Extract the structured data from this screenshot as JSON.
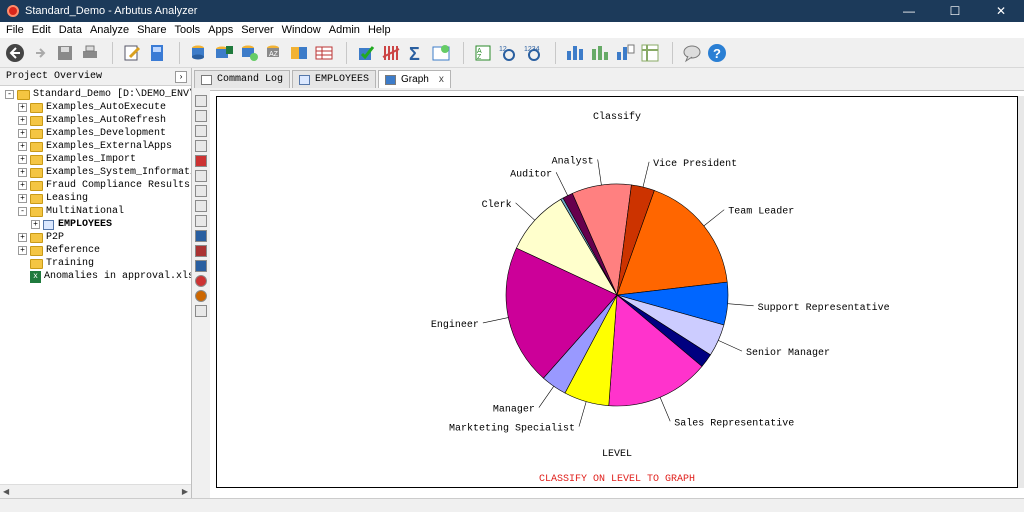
{
  "window": {
    "title": "Standard_Demo - Arbutus Analyzer",
    "minimize": "—",
    "maximize": "☐",
    "close": "✕"
  },
  "menu": [
    "File",
    "Edit",
    "Data",
    "Analyze",
    "Share",
    "Tools",
    "Apps",
    "Server",
    "Window",
    "Admin",
    "Help"
  ],
  "left_panel": {
    "title": "Project Overview",
    "tree": [
      {
        "label": "Standard_Demo [D:\\DEMO_ENV\\ARBU",
        "level": 0,
        "exp": "-",
        "icon": "folder"
      },
      {
        "label": "Examples_AutoExecute",
        "level": 1,
        "exp": "+",
        "icon": "folder"
      },
      {
        "label": "Examples_AutoRefresh",
        "level": 1,
        "exp": "+",
        "icon": "folder"
      },
      {
        "label": "Examples_Development",
        "level": 1,
        "exp": "+",
        "icon": "folder"
      },
      {
        "label": "Examples_ExternalApps",
        "level": 1,
        "exp": "+",
        "icon": "folder"
      },
      {
        "label": "Examples_Import",
        "level": 1,
        "exp": "+",
        "icon": "folder"
      },
      {
        "label": "Examples_System_Information",
        "level": 1,
        "exp": "+",
        "icon": "folder"
      },
      {
        "label": "Fraud Compliance Results",
        "level": 1,
        "exp": "+",
        "icon": "folder"
      },
      {
        "label": "Leasing",
        "level": 1,
        "exp": "+",
        "icon": "folder"
      },
      {
        "label": "MultiNational",
        "level": 1,
        "exp": "-",
        "icon": "folder"
      },
      {
        "label": "EMPLOYEES",
        "level": 2,
        "exp": "+",
        "icon": "table",
        "bold": true
      },
      {
        "label": "P2P",
        "level": 1,
        "exp": "+",
        "icon": "folder"
      },
      {
        "label": "Reference",
        "level": 1,
        "exp": "+",
        "icon": "folder"
      },
      {
        "label": "Training",
        "level": 1,
        "exp": "",
        "icon": "folder"
      },
      {
        "label": "Anomalies in approval.xlsx",
        "level": 1,
        "exp": "",
        "icon": "xlsx"
      }
    ]
  },
  "tabs": [
    {
      "label": "Command Log",
      "active": false,
      "close": ""
    },
    {
      "label": "EMPLOYEES",
      "active": false,
      "close": ""
    },
    {
      "label": "Graph",
      "active": true,
      "close": "x"
    }
  ],
  "chart_data": {
    "type": "pie",
    "title": "Classify",
    "xlabel": "LEVEL",
    "caption": "CLASSIFY ON LEVEL TO GRAPH",
    "categories": [
      "Clerk",
      "Auditor",
      "Analyst",
      "Vice President",
      "Team Leader",
      "Support Representative",
      "Senior Manager",
      "Sales Representative",
      "Markteting Specialist",
      "Manager",
      "Engineer"
    ],
    "values": [
      10.2,
      1.8,
      9.2,
      3.6,
      18.8,
      6.6,
      5.0,
      2.2,
      16.0,
      7.0,
      4.0,
      21.7
    ],
    "slices": [
      {
        "label": "Clerk",
        "value": 10.2,
        "color": "#ffffcc"
      },
      {
        "label": "",
        "value": 0.4,
        "color": "#6fa8c8"
      },
      {
        "label": "Auditor",
        "value": 1.6,
        "color": "#66004d"
      },
      {
        "label": "Analyst",
        "value": 9.2,
        "color": "#ff8080"
      },
      {
        "label": "Vice President",
        "value": 3.6,
        "color": "#cc3300"
      },
      {
        "label": "Team Leader",
        "value": 18.8,
        "color": "#ff6600"
      },
      {
        "label": "Support Representative",
        "value": 6.6,
        "color": "#0066ff"
      },
      {
        "label": "Senior Manager",
        "value": 5.0,
        "color": "#ccccff"
      },
      {
        "label": "",
        "value": 2.2,
        "color": "#000080"
      },
      {
        "label": "Sales Representative",
        "value": 16.0,
        "color": "#ff33cc"
      },
      {
        "label": "Markteting Specialist",
        "value": 7.0,
        "color": "#ffff00"
      },
      {
        "label": "Manager",
        "value": 4.0,
        "color": "#9999ff"
      },
      {
        "label": "Engineer",
        "value": 21.7,
        "color": "#cc0099"
      }
    ]
  }
}
